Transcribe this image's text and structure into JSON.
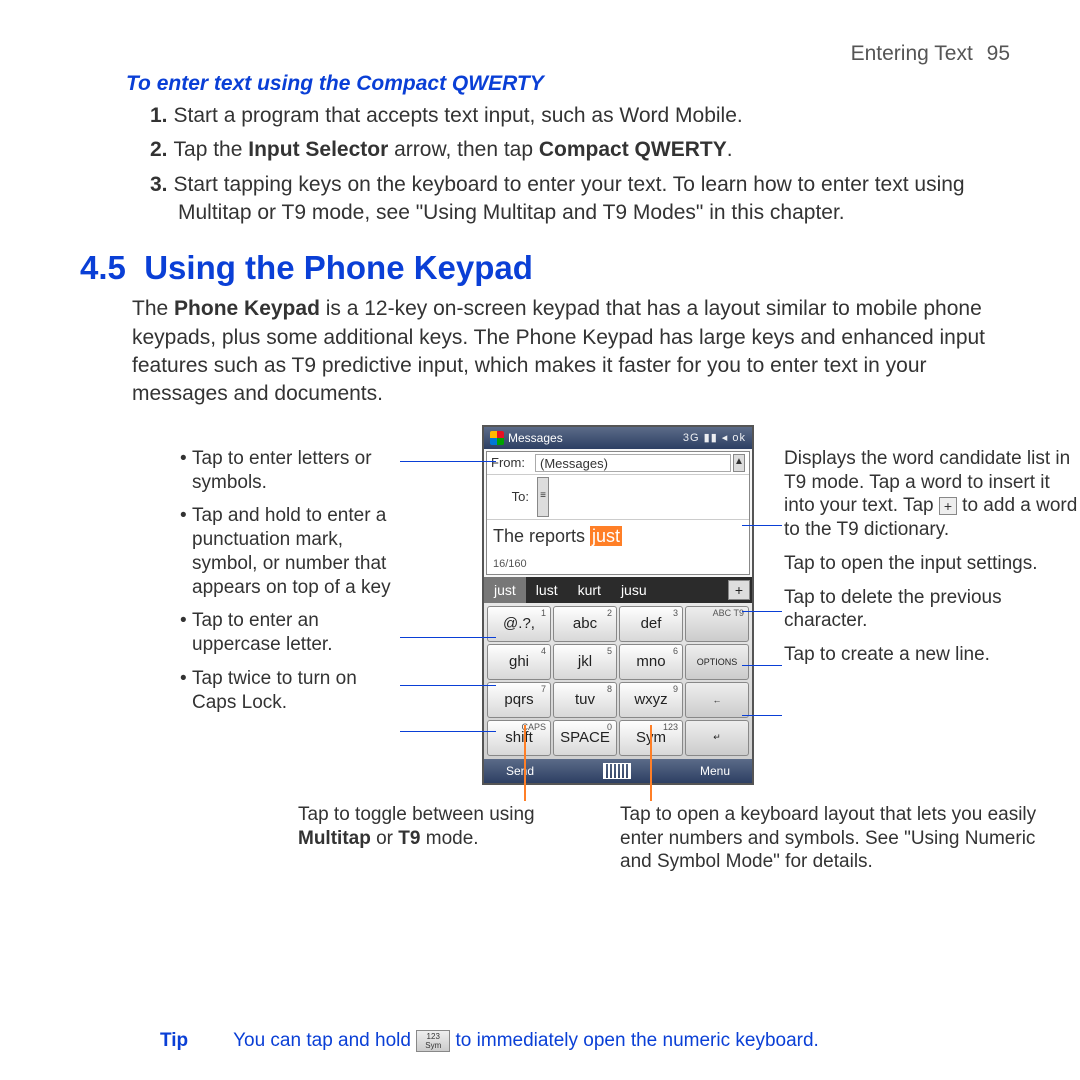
{
  "header": {
    "section": "Entering Text",
    "page": "95"
  },
  "sub": {
    "title": "To enter text using the Compact QWERTY"
  },
  "steps": [
    {
      "n": "1.",
      "t": "Start a program that accepts text input, such as Word Mobile."
    },
    {
      "n": "2.",
      "t_pre": "Tap the ",
      "b1": "Input Selector",
      "t_mid": " arrow, then tap ",
      "b2": "Compact QWERTY",
      "t_post": "."
    },
    {
      "n": "3.",
      "t": "Start tapping keys on the keyboard to enter your text. To learn how to enter text using Multitap or T9 mode, see \"Using Multitap and T9 Modes\" in this chapter."
    }
  ],
  "section": {
    "num": "4.5",
    "title": "Using the Phone Keypad"
  },
  "intro": {
    "pre": "The ",
    "b": "Phone Keypad",
    "post": " is a 12-key on-screen keypad that has a layout similar to mobile phone keypads, plus some additional keys. The Phone Keypad has large keys and enhanced input features such as T9 predictive input, which makes it faster for you to enter text in your messages and documents."
  },
  "left": [
    "Tap to enter letters or symbols.",
    "Tap and hold to enter a punctuation mark, symbol, or number that appears on top of a key",
    "Tap to enter an uppercase letter.",
    "Tap twice to turn on Caps Lock."
  ],
  "right": {
    "cand_pre": "Displays the word candidate list in T9 mode. Tap a word to insert it into your text. Tap ",
    "cand_post": " to add a word to the T9 dictionary.",
    "settings": "Tap to open the input settings.",
    "del": "Tap to delete the previous character.",
    "enter": "Tap to create a new line."
  },
  "toggle": {
    "pre": "Tap to toggle between using ",
    "b1": "Multitap",
    "mid": " or ",
    "b2": "T9",
    "post": " mode."
  },
  "symnote": "Tap to open a keyboard layout that lets you easily enter numbers and symbols. See \"Using Numeric and Symbol Mode\" for details.",
  "tip": {
    "lbl": "Tip",
    "pre": "You can tap and hold ",
    "sym_top": "123",
    "sym_bot": "Sym",
    "post": " to immediately open the numeric keyboard."
  },
  "phone": {
    "title": "Messages",
    "status": "3G  ▮▮  ◂  ok",
    "from_lbl": "From:",
    "from_val": "(Messages)",
    "to_lbl": "To:",
    "msg_pre": "The reports ",
    "msg_hl": "just",
    "count": "16/160",
    "cands": [
      "just",
      "lust",
      "kurt",
      "jusu"
    ],
    "plus": "+",
    "keys": [
      [
        {
          "sup": "1",
          "t": "@.?,"
        },
        {
          "sup": "2",
          "t": "abc"
        },
        {
          "sup": "3",
          "t": "def"
        },
        {
          "sup": "ABC T9",
          "t": "",
          "opt": true
        }
      ],
      [
        {
          "sup": "4",
          "t": "ghi"
        },
        {
          "sup": "5",
          "t": "jkl"
        },
        {
          "sup": "6",
          "t": "mno"
        },
        {
          "sup": "",
          "t": "OPTIONS",
          "opt": true
        }
      ],
      [
        {
          "sup": "7",
          "t": "pqrs"
        },
        {
          "sup": "8",
          "t": "tuv"
        },
        {
          "sup": "9",
          "t": "wxyz"
        },
        {
          "sup": "",
          "t": "←",
          "opt": true
        }
      ],
      [
        {
          "sup": "CAPS",
          "t": "shift"
        },
        {
          "sup": "0",
          "t": "SPACE"
        },
        {
          "sup": "123",
          "t": "Sym"
        },
        {
          "sup": "",
          "t": "↵",
          "opt": true
        }
      ]
    ],
    "foot_l": "Send",
    "foot_r": "Menu"
  }
}
